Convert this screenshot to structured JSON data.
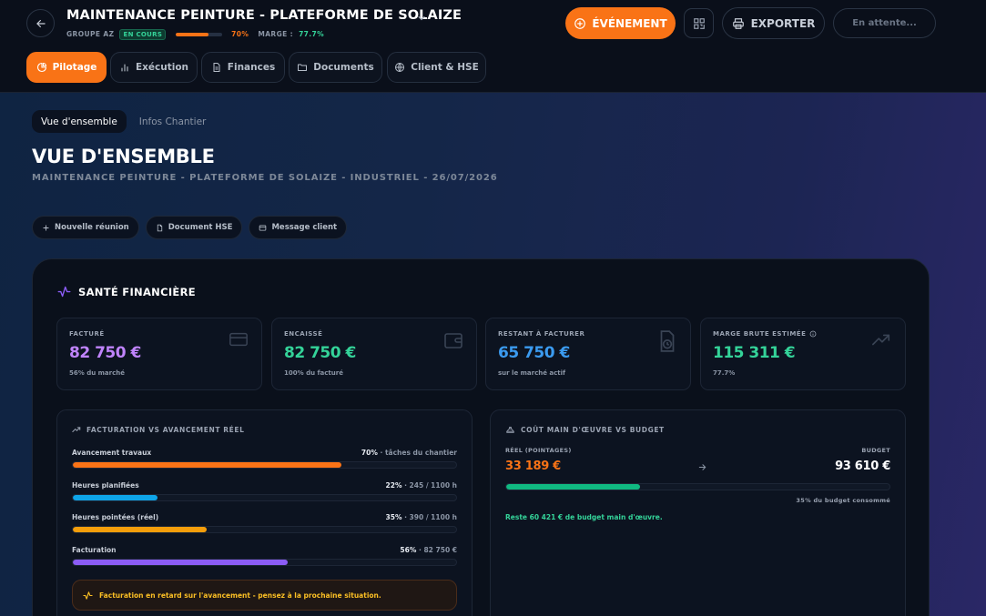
{
  "header": {
    "title": "MAINTENANCE PEINTURE - PLATEFORME DE SOLAIZE",
    "group": "GROUPE AZ",
    "status": "EN COURS",
    "progress_pct": 70,
    "progress_label": "70%",
    "marge_label": "MARGE :",
    "marge_value": "77.7%",
    "event_label": "ÉVÉNEMENT",
    "export_label": "EXPORTER",
    "waiting_label": "En attente..."
  },
  "tabs": [
    {
      "label": "Pilotage",
      "active": true,
      "icon": "pie-chart-icon"
    },
    {
      "label": "Exécution",
      "icon": "bar-chart-icon"
    },
    {
      "label": "Finances",
      "icon": "file-icon"
    },
    {
      "label": "Documents",
      "icon": "folder-icon"
    },
    {
      "label": "Client & HSE",
      "icon": "globe-icon"
    }
  ],
  "subtabs": [
    {
      "label": "Vue d'ensemble",
      "active": true
    },
    {
      "label": "Infos Chantier"
    }
  ],
  "page": {
    "title": "VUE D'ENSEMBLE",
    "subtitle": "MAINTENANCE PEINTURE - PLATEFORME DE SOLAIZE - INDUSTRIEL - 26/07/2026"
  },
  "actions": [
    {
      "label": "Nouvelle réunion",
      "icon": "plus-icon"
    },
    {
      "label": "Document HSE",
      "icon": "document-icon"
    },
    {
      "label": "Message client",
      "icon": "message-icon"
    }
  ],
  "finance": {
    "title": "SANTÉ FINANCIÈRE",
    "kpis": [
      {
        "label": "FACTURÉ",
        "value": "82 750 €",
        "sub": "56% du marché",
        "color": "#c084fc",
        "icon": "credit-card-icon"
      },
      {
        "label": "ENCAISSÉ",
        "value": "82 750 €",
        "sub": "100% du facturé",
        "color": "#34d399",
        "icon": "wallet-icon"
      },
      {
        "label": "RESTANT À FACTURER",
        "value": "65 750 €",
        "sub": "sur le marché actif",
        "color": "#3b9bf0",
        "icon": "file-clock-icon"
      },
      {
        "label": "MARGE BRUTE ESTIMÉE",
        "value": "115 311 €",
        "sub": "77.7%",
        "color": "#34d399",
        "icon": "trending-up-icon"
      }
    ]
  },
  "billing_panel": {
    "title": "FACTURATION VS AVANCEMENT RÉEL",
    "rows": [
      {
        "label": "Avancement travaux",
        "pct_label": "70%",
        "detail": "· tâches du chantier",
        "pct": 70,
        "color": "#f97316"
      },
      {
        "label": "Heures planifiées",
        "pct_label": "22%",
        "detail": "· 245 / 1100 h",
        "pct": 22,
        "color": "#0ea5e9"
      },
      {
        "label": "Heures pointées (réel)",
        "pct_label": "35%",
        "detail": "· 390 / 1100 h",
        "pct": 35,
        "color": "#f59e0b"
      },
      {
        "label": "Facturation",
        "pct_label": "56%",
        "detail": "· 82 750 €",
        "pct": 56,
        "color": "#8b5cf6"
      }
    ],
    "alert": "Facturation en retard sur l'avancement - pensez à la prochaine situation."
  },
  "labor_panel": {
    "title": "COÛT MAIN D'ŒUVRE VS BUDGET",
    "real_label": "RÉEL (POINTAGES)",
    "real_value": "33 189 €",
    "budget_label": "BUDGET",
    "budget_value": "93 610 €",
    "consumed_pct": 35,
    "consumed_label": "35% du budget consommé",
    "remaining": "Reste 60 421 € de budget main d'œuvre."
  }
}
